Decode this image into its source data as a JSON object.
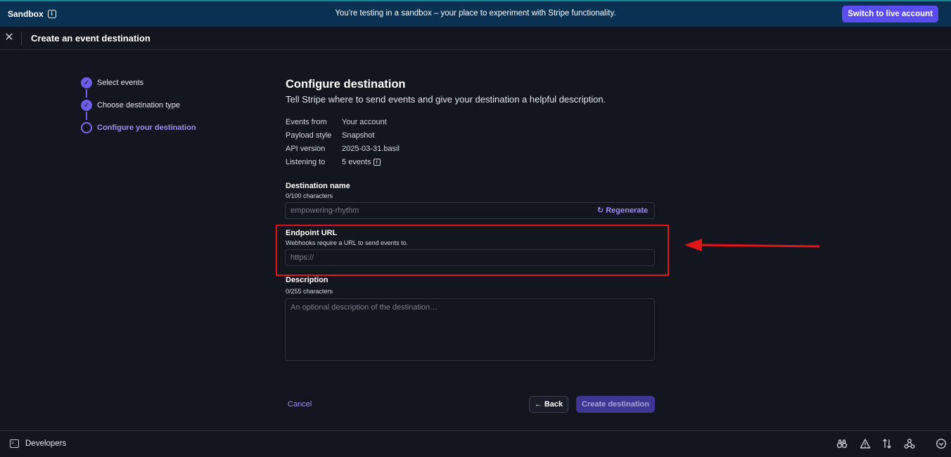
{
  "banner": {
    "sandbox_label": "Sandbox",
    "message": "You're testing in a sandbox – your place to experiment with Stripe functionality.",
    "live_button": "Switch to live account"
  },
  "header": {
    "title": "Create an event destination"
  },
  "steps": [
    {
      "label": "Select events",
      "state": "complete"
    },
    {
      "label": "Choose destination type",
      "state": "complete"
    },
    {
      "label": "Configure your destination",
      "state": "current"
    }
  ],
  "form": {
    "title": "Configure destination",
    "subtitle": "Tell Stripe where to send events and give your destination a helpful description.",
    "details": [
      {
        "key": "Events from",
        "value": "Your account"
      },
      {
        "key": "Payload style",
        "value": "Snapshot"
      },
      {
        "key": "API version",
        "value": "2025-03-31.basil"
      },
      {
        "key": "Listening to",
        "value": "5 events"
      }
    ],
    "destination_name": {
      "label": "Destination name",
      "counter": "0/100 characters",
      "placeholder": "empowering-rhythm",
      "regenerate": "Regenerate"
    },
    "endpoint_url": {
      "label": "Endpoint URL",
      "hint": "Webhooks require a URL to send events to.",
      "placeholder": "https://"
    },
    "description": {
      "label": "Description",
      "counter": "0/255 characters",
      "placeholder": "An optional description of the destination…"
    },
    "cancel": "Cancel",
    "back": "Back",
    "create": "Create destination"
  },
  "footer": {
    "label": "Developers"
  },
  "colors": {
    "accent": "#6c5ce7",
    "highlight": "#e0161a",
    "banner": "#0b3152"
  }
}
